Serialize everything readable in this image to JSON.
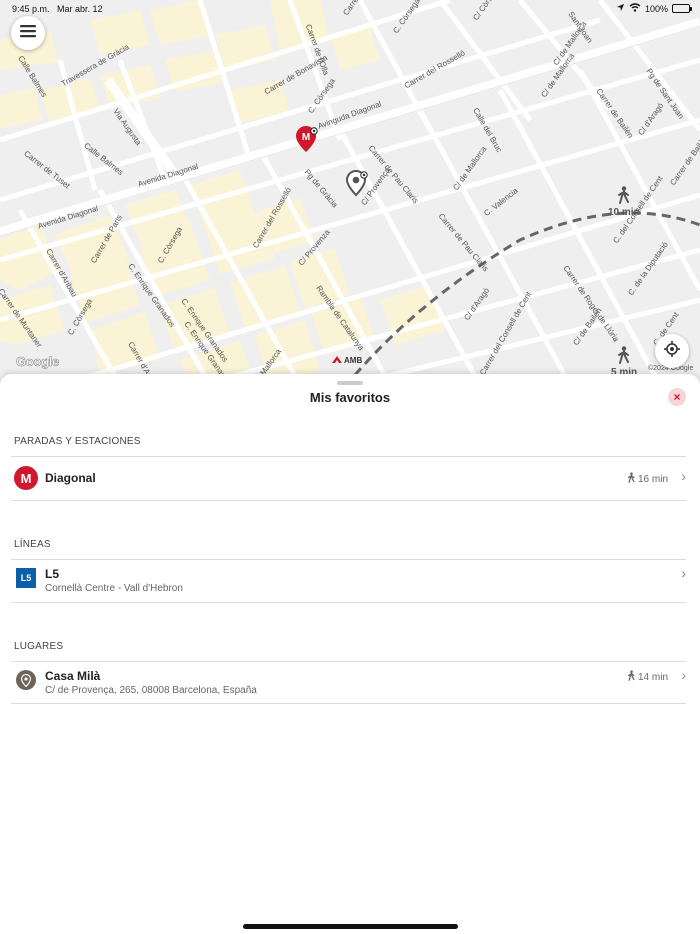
{
  "status": {
    "time": "9:45 p.m.",
    "date": "Mar abr. 12",
    "battery": "100%"
  },
  "map": {
    "streets": [
      "Calle Balmes",
      "Travessera de Gràcia",
      "Via Augusta",
      "Calle Balmes",
      "Carrer de Tuset",
      "Avenida Diagonal",
      "Avenida Diagonal",
      "Avinguda Diagonal",
      "Carrer de Bonavista",
      "C. Còrsega",
      "Carrer del Rosselló",
      "C. Còrsega",
      "Carrer de l'Olla",
      "Pg de Gràcia",
      "C/ Provença",
      "Carrer de Pau Claris",
      "Calle del Bruc",
      "C/ de Mallorca",
      "C/ de Mallorca",
      "C. Valencia",
      "Carrer de Pau Claris",
      "Carrer del Rosselló",
      "Carrer de Paris",
      "C. Còrsega",
      "Carrer d'Aribau",
      "C. Enrique Granados",
      "C. Enrique Granados",
      "C. Enrique Granados",
      "C/ Provenza",
      "Rambla de Catalunya",
      "Carrer de Muntaner",
      "C. Còrsega",
      "Carrer d'Aribau",
      "Mallorca",
      "Carrer de Roger de Llúria",
      "C/ d'Aragó",
      "C/ d'Aragó",
      "Carrer del Consell de Cent",
      "C. del Consell de Cent",
      "C. de la Diputació",
      "Carrer de Bailèn",
      "C/ de Bailèn",
      "Pg de Sant Joan",
      "C/ de Mallorca",
      "C/ Còrsega",
      "Carrer del Rosselló",
      "Sant Joan",
      "C. de Cent",
      "Carrer de Bailèn"
    ],
    "walk_far": "10 min",
    "walk_near": "5 min",
    "google_logo": "Google",
    "copyright": "©2024 Google",
    "amb": "AMB"
  },
  "sheet": {
    "title": "Mis favoritos",
    "close_label": "×",
    "sections": {
      "stops": {
        "title": "PARADAS Y ESTACIONES",
        "items": [
          {
            "icon_letter": "M",
            "title": "Diagonal",
            "eta": "16 min"
          }
        ]
      },
      "lines": {
        "title": "LÍNEAS",
        "items": [
          {
            "badge": "L5",
            "title": "L5",
            "subtitle": "Cornellà Centre - Vall d'Hebron"
          }
        ]
      },
      "places": {
        "title": "LUGARES",
        "items": [
          {
            "title": "Casa Milà",
            "subtitle": "C/ de Provença, 265, 08008 Barcelona, España",
            "eta": "14 min"
          }
        ]
      }
    }
  },
  "colors": {
    "metro_red": "#d0172b",
    "line_blue": "#0a5fa8",
    "place_brown": "#6e6357",
    "map_block": "#fbf3d6",
    "map_road": "#ffffff"
  }
}
